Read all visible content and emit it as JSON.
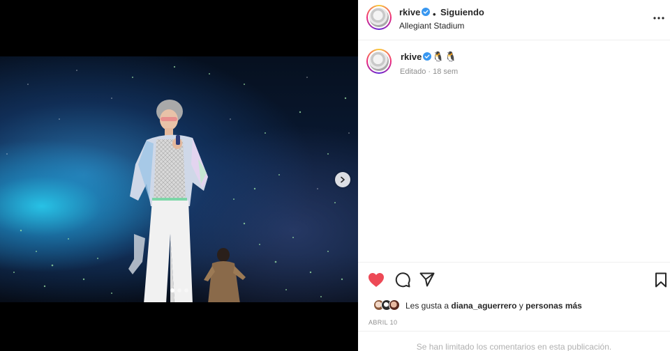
{
  "post": {
    "username": "rkive",
    "follow_status": "Siguiendo",
    "separator": "•",
    "location": "Allegiant Stadium",
    "caption_emoji": "🐧🐧",
    "edited_label": "Editado",
    "time_ago": "18 sem",
    "date": "ABRIL 10",
    "comments_limited": "Se han limitado los comentarios en esta publicación."
  },
  "likes": {
    "prefix": "Les gusta a",
    "user": "diana_aguerrero",
    "conjunction": "y",
    "suffix": "personas más"
  },
  "carousel": {
    "total": 3,
    "active_index": 0
  },
  "icons": {
    "verified": "verified-badge-icon",
    "more": "more-options-icon",
    "like": "heart-filled-icon",
    "comment": "comment-bubble-icon",
    "share": "paper-plane-icon",
    "save": "bookmark-icon",
    "next": "chevron-right-icon"
  },
  "colors": {
    "like_red": "#ed4956",
    "verified_blue": "#3897f0",
    "text": "#262626",
    "muted": "#8e8e8e"
  }
}
